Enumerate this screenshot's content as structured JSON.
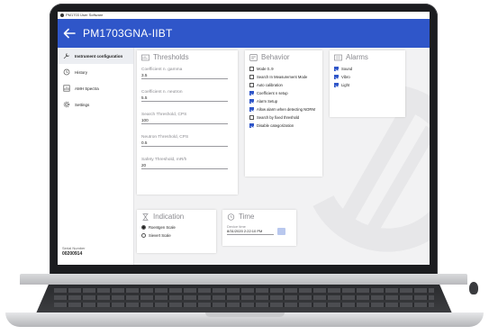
{
  "window": {
    "title": "PM1703 User Software"
  },
  "header": {
    "title": "PM1703GNA-IIBT"
  },
  "sidebar": {
    "items": [
      {
        "label": "Instrument configuration",
        "icon": "wrench-icon",
        "active": true
      },
      {
        "label": "History",
        "icon": "history-icon",
        "active": false
      },
      {
        "label": "AMH Spectra",
        "icon": "spectrum-icon",
        "active": false
      },
      {
        "label": "Settings",
        "icon": "gear-icon",
        "active": false
      }
    ],
    "serial_label": "Serial Number",
    "serial_value": "00200914"
  },
  "thresholds": {
    "title": "Thresholds",
    "fields": [
      {
        "label": "Coefficient n. gamma",
        "value": "3.5"
      },
      {
        "label": "Coefficient n. neutron",
        "value": "5.5"
      },
      {
        "label": "Search Threshold, CPS",
        "value": "100"
      },
      {
        "label": "Neutron Threshold, CPS",
        "value": "0.5"
      },
      {
        "label": "Safety Threshold, mR/h",
        "value": "20"
      }
    ]
  },
  "behavior": {
    "title": "Behavior",
    "options": [
      {
        "label": "Mode 0..9",
        "checked": false
      },
      {
        "label": "Search In Measurement Mode",
        "checked": false
      },
      {
        "label": "Auto calibration",
        "checked": false
      },
      {
        "label": "Coefficient n setup",
        "checked": true
      },
      {
        "label": "Alarm Setup",
        "checked": true
      },
      {
        "label": "Allow alarm when detecting NORM",
        "checked": true
      },
      {
        "label": "Search by fixed threshold",
        "checked": false
      },
      {
        "label": "Disable categorization",
        "checked": true
      }
    ]
  },
  "alarms": {
    "title": "Alarms",
    "options": [
      {
        "label": "Sound",
        "checked": true
      },
      {
        "label": "Vibro",
        "checked": true
      },
      {
        "label": "Light",
        "checked": true
      }
    ]
  },
  "indication": {
    "title": "Indication",
    "options": [
      {
        "label": "Roentgen Scale",
        "selected": true
      },
      {
        "label": "Sievert Scale",
        "selected": false
      }
    ]
  },
  "time": {
    "title": "Time",
    "device_time_label": "Device time",
    "device_time_value": "8/31/2020 2:22:10 PM"
  },
  "colors": {
    "accent": "#2f56c9",
    "sidebar_active": "#eceef2",
    "panel_heading": "#8a8a8f"
  }
}
